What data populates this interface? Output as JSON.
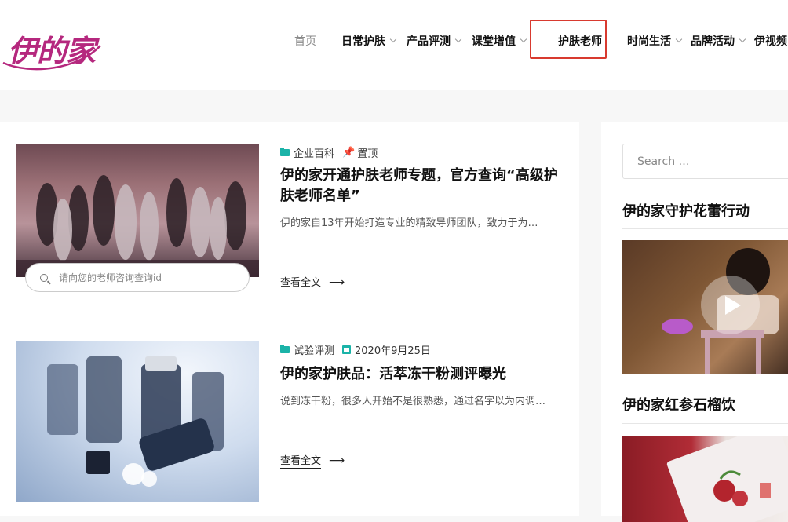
{
  "logo": {
    "text": "伊的家"
  },
  "nav": {
    "items": [
      {
        "label": "首页",
        "has_dropdown": false
      },
      {
        "label": "日常护肤",
        "has_dropdown": true
      },
      {
        "label": "产品评测",
        "has_dropdown": true
      },
      {
        "label": "课堂增值",
        "has_dropdown": true
      },
      {
        "label": "护肤老师",
        "has_dropdown": false,
        "highlighted": true
      },
      {
        "label": "时尚生活",
        "has_dropdown": true
      },
      {
        "label": "品牌活动",
        "has_dropdown": true
      },
      {
        "label": "伊视频",
        "has_dropdown": false
      }
    ],
    "highlight_color": "#d83a2f"
  },
  "posts": [
    {
      "category": "企业百科",
      "pinned_label": "置顶",
      "title": "伊的家开通护肤老师专题，官方查询“高级护肤老师名单”",
      "excerpt": "伊的家自13年开始打造专业的精致导师团队，致力于为…",
      "read_more": "查看全文",
      "search_placeholder": "请向您的老师咨询查询id"
    },
    {
      "category": "试验评测",
      "date": "2020年9月25日",
      "title": "伊的家护肤品：活萃冻干粉测评曝光",
      "excerpt": "说到冻干粉，很多人开始不是很熟悉，通过名字以为内调…",
      "read_more": "查看全文"
    }
  ],
  "sidebar": {
    "search_placeholder": "Search …",
    "widgets": [
      {
        "title": "伊的家守护花蕾行动"
      },
      {
        "title": "伊的家红参石榴饮"
      }
    ]
  },
  "colors": {
    "accent": "#1bb3a8",
    "brand": "#b5287e"
  }
}
